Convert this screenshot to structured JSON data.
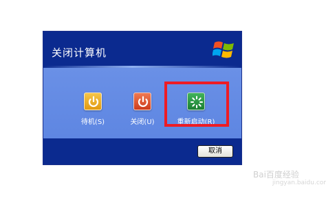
{
  "dialog": {
    "title": "关闭计算机",
    "options": [
      {
        "id": "standby",
        "label": "待机(S)",
        "icon": "power-icon"
      },
      {
        "id": "shutdown",
        "label": "关闭(U)",
        "icon": "power-icon"
      },
      {
        "id": "restart",
        "label": "重新启动(R)",
        "icon": "restart-icon"
      }
    ],
    "cancel_label": "取消"
  },
  "annotation": {
    "highlight_color": "#ee1c24"
  },
  "watermark": {
    "text": "Bai百度经验",
    "url": "jingyan.baidu.com"
  },
  "colors": {
    "title_bar": "#0b2a8f",
    "body": "#6a90e6",
    "standby": "#e8a81e",
    "shutdown": "#d9472a",
    "restart": "#2a9a45"
  }
}
